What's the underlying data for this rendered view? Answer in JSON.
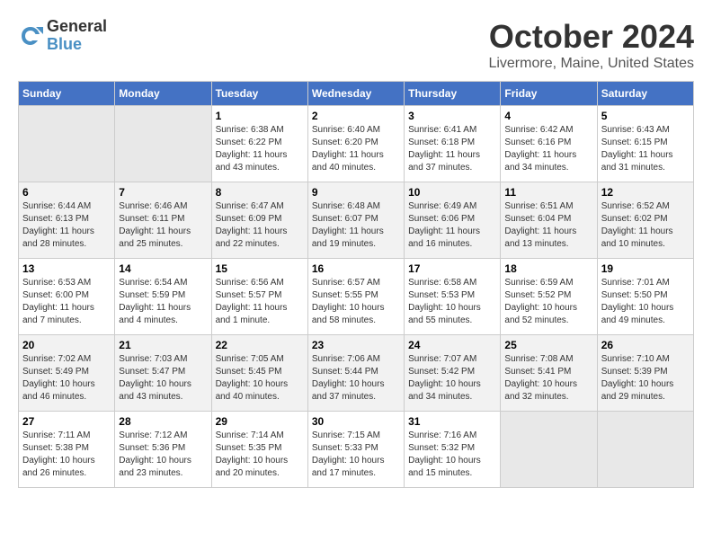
{
  "header": {
    "logo_line1": "General",
    "logo_line2": "Blue",
    "month_title": "October 2024",
    "location": "Livermore, Maine, United States"
  },
  "weekdays": [
    "Sunday",
    "Monday",
    "Tuesday",
    "Wednesday",
    "Thursday",
    "Friday",
    "Saturday"
  ],
  "weeks": [
    [
      {
        "day": "",
        "info": ""
      },
      {
        "day": "",
        "info": ""
      },
      {
        "day": "1",
        "info": "Sunrise: 6:38 AM\nSunset: 6:22 PM\nDaylight: 11 hours and 43 minutes."
      },
      {
        "day": "2",
        "info": "Sunrise: 6:40 AM\nSunset: 6:20 PM\nDaylight: 11 hours and 40 minutes."
      },
      {
        "day": "3",
        "info": "Sunrise: 6:41 AM\nSunset: 6:18 PM\nDaylight: 11 hours and 37 minutes."
      },
      {
        "day": "4",
        "info": "Sunrise: 6:42 AM\nSunset: 6:16 PM\nDaylight: 11 hours and 34 minutes."
      },
      {
        "day": "5",
        "info": "Sunrise: 6:43 AM\nSunset: 6:15 PM\nDaylight: 11 hours and 31 minutes."
      }
    ],
    [
      {
        "day": "6",
        "info": "Sunrise: 6:44 AM\nSunset: 6:13 PM\nDaylight: 11 hours and 28 minutes."
      },
      {
        "day": "7",
        "info": "Sunrise: 6:46 AM\nSunset: 6:11 PM\nDaylight: 11 hours and 25 minutes."
      },
      {
        "day": "8",
        "info": "Sunrise: 6:47 AM\nSunset: 6:09 PM\nDaylight: 11 hours and 22 minutes."
      },
      {
        "day": "9",
        "info": "Sunrise: 6:48 AM\nSunset: 6:07 PM\nDaylight: 11 hours and 19 minutes."
      },
      {
        "day": "10",
        "info": "Sunrise: 6:49 AM\nSunset: 6:06 PM\nDaylight: 11 hours and 16 minutes."
      },
      {
        "day": "11",
        "info": "Sunrise: 6:51 AM\nSunset: 6:04 PM\nDaylight: 11 hours and 13 minutes."
      },
      {
        "day": "12",
        "info": "Sunrise: 6:52 AM\nSunset: 6:02 PM\nDaylight: 11 hours and 10 minutes."
      }
    ],
    [
      {
        "day": "13",
        "info": "Sunrise: 6:53 AM\nSunset: 6:00 PM\nDaylight: 11 hours and 7 minutes."
      },
      {
        "day": "14",
        "info": "Sunrise: 6:54 AM\nSunset: 5:59 PM\nDaylight: 11 hours and 4 minutes."
      },
      {
        "day": "15",
        "info": "Sunrise: 6:56 AM\nSunset: 5:57 PM\nDaylight: 11 hours and 1 minute."
      },
      {
        "day": "16",
        "info": "Sunrise: 6:57 AM\nSunset: 5:55 PM\nDaylight: 10 hours and 58 minutes."
      },
      {
        "day": "17",
        "info": "Sunrise: 6:58 AM\nSunset: 5:53 PM\nDaylight: 10 hours and 55 minutes."
      },
      {
        "day": "18",
        "info": "Sunrise: 6:59 AM\nSunset: 5:52 PM\nDaylight: 10 hours and 52 minutes."
      },
      {
        "day": "19",
        "info": "Sunrise: 7:01 AM\nSunset: 5:50 PM\nDaylight: 10 hours and 49 minutes."
      }
    ],
    [
      {
        "day": "20",
        "info": "Sunrise: 7:02 AM\nSunset: 5:49 PM\nDaylight: 10 hours and 46 minutes."
      },
      {
        "day": "21",
        "info": "Sunrise: 7:03 AM\nSunset: 5:47 PM\nDaylight: 10 hours and 43 minutes."
      },
      {
        "day": "22",
        "info": "Sunrise: 7:05 AM\nSunset: 5:45 PM\nDaylight: 10 hours and 40 minutes."
      },
      {
        "day": "23",
        "info": "Sunrise: 7:06 AM\nSunset: 5:44 PM\nDaylight: 10 hours and 37 minutes."
      },
      {
        "day": "24",
        "info": "Sunrise: 7:07 AM\nSunset: 5:42 PM\nDaylight: 10 hours and 34 minutes."
      },
      {
        "day": "25",
        "info": "Sunrise: 7:08 AM\nSunset: 5:41 PM\nDaylight: 10 hours and 32 minutes."
      },
      {
        "day": "26",
        "info": "Sunrise: 7:10 AM\nSunset: 5:39 PM\nDaylight: 10 hours and 29 minutes."
      }
    ],
    [
      {
        "day": "27",
        "info": "Sunrise: 7:11 AM\nSunset: 5:38 PM\nDaylight: 10 hours and 26 minutes."
      },
      {
        "day": "28",
        "info": "Sunrise: 7:12 AM\nSunset: 5:36 PM\nDaylight: 10 hours and 23 minutes."
      },
      {
        "day": "29",
        "info": "Sunrise: 7:14 AM\nSunset: 5:35 PM\nDaylight: 10 hours and 20 minutes."
      },
      {
        "day": "30",
        "info": "Sunrise: 7:15 AM\nSunset: 5:33 PM\nDaylight: 10 hours and 17 minutes."
      },
      {
        "day": "31",
        "info": "Sunrise: 7:16 AM\nSunset: 5:32 PM\nDaylight: 10 hours and 15 minutes."
      },
      {
        "day": "",
        "info": ""
      },
      {
        "day": "",
        "info": ""
      }
    ]
  ]
}
